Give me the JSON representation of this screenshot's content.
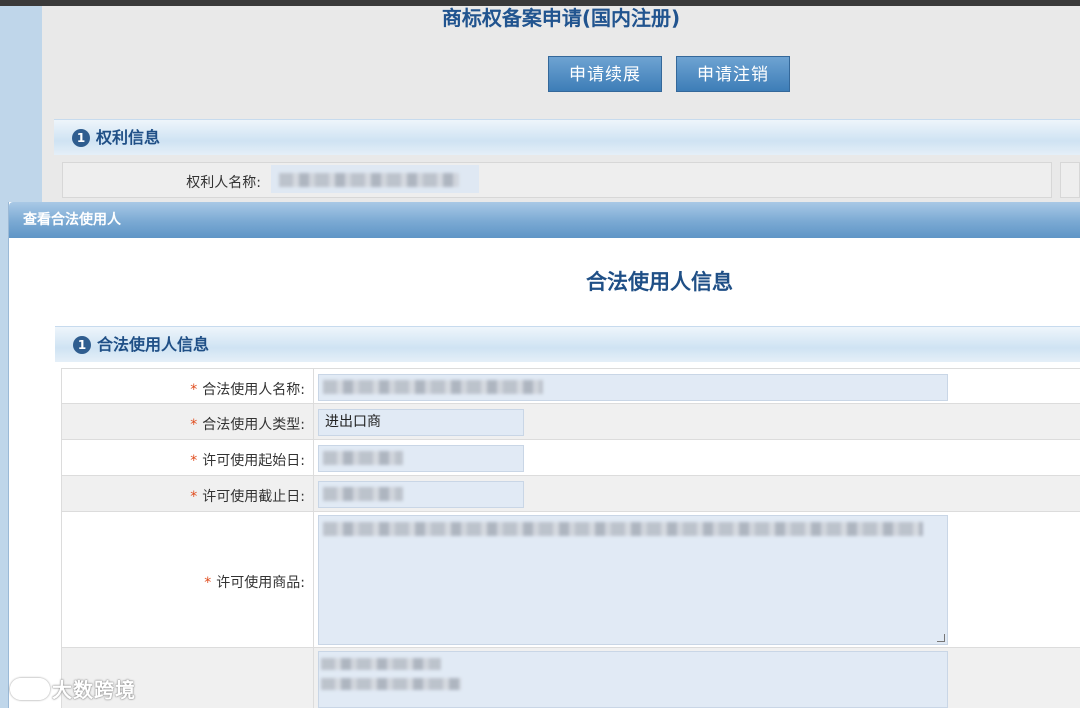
{
  "background": {
    "page_title": "商标权备案申请(国内注册)",
    "buttons": {
      "renew": "申请续展",
      "cancel": "申请注销"
    },
    "section": {
      "num": "1",
      "title": "权利信息"
    },
    "owner_label": "权利人名称:"
  },
  "dialog": {
    "title": "查看合法使用人",
    "heading": "合法使用人信息",
    "section": {
      "num": "1",
      "title": "合法使用人信息"
    },
    "fields": {
      "name_label": "合法使用人名称:",
      "type_label": "合法使用人类型:",
      "type_value": "进出口商",
      "start_label": "许可使用起始日:",
      "end_label": "许可使用截止日:",
      "goods_label": "许可使用商品:",
      "required_mark": "*"
    }
  },
  "watermark": {
    "text": "大数跨境",
    "icon": "logo-icon"
  },
  "colors": {
    "accent": "#1f4f86",
    "button": "#4a87c0",
    "required": "#e04b1c",
    "input_bg": "#e1eaf5"
  }
}
